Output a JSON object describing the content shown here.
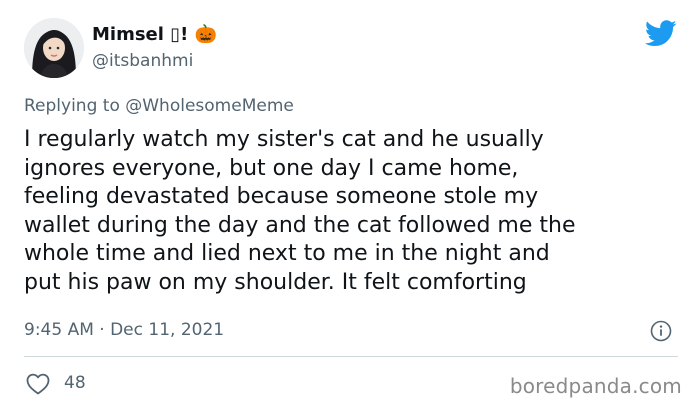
{
  "author": {
    "display_name": "Mimsel ▯! 🎃",
    "handle": "@itsbanhmi"
  },
  "reply_context": {
    "prefix": "Replying to ",
    "mention": "@WholesomeMeme"
  },
  "tweet": {
    "lines": [
      "I regularly watch my sister's cat and he usually",
      "ignores everyone, but one day I came home,",
      "feeling devastated because someone stole my",
      "wallet during the day and the cat followed me the",
      "whole time and lied next to me in the night and",
      "put his paw on my shoulder. It felt comforting"
    ],
    "timestamp": "9:45 AM · Dec 11, 2021",
    "like_count": "48"
  },
  "watermark": "boredpanda.com",
  "icons": {
    "brand": "twitter-bird-icon",
    "info": "info-icon",
    "like": "heart-outline-icon"
  },
  "colors": {
    "brand_blue": "#1d9bf0",
    "text_primary": "#0f1419",
    "text_secondary": "#536471",
    "divider": "#cfd9de"
  }
}
